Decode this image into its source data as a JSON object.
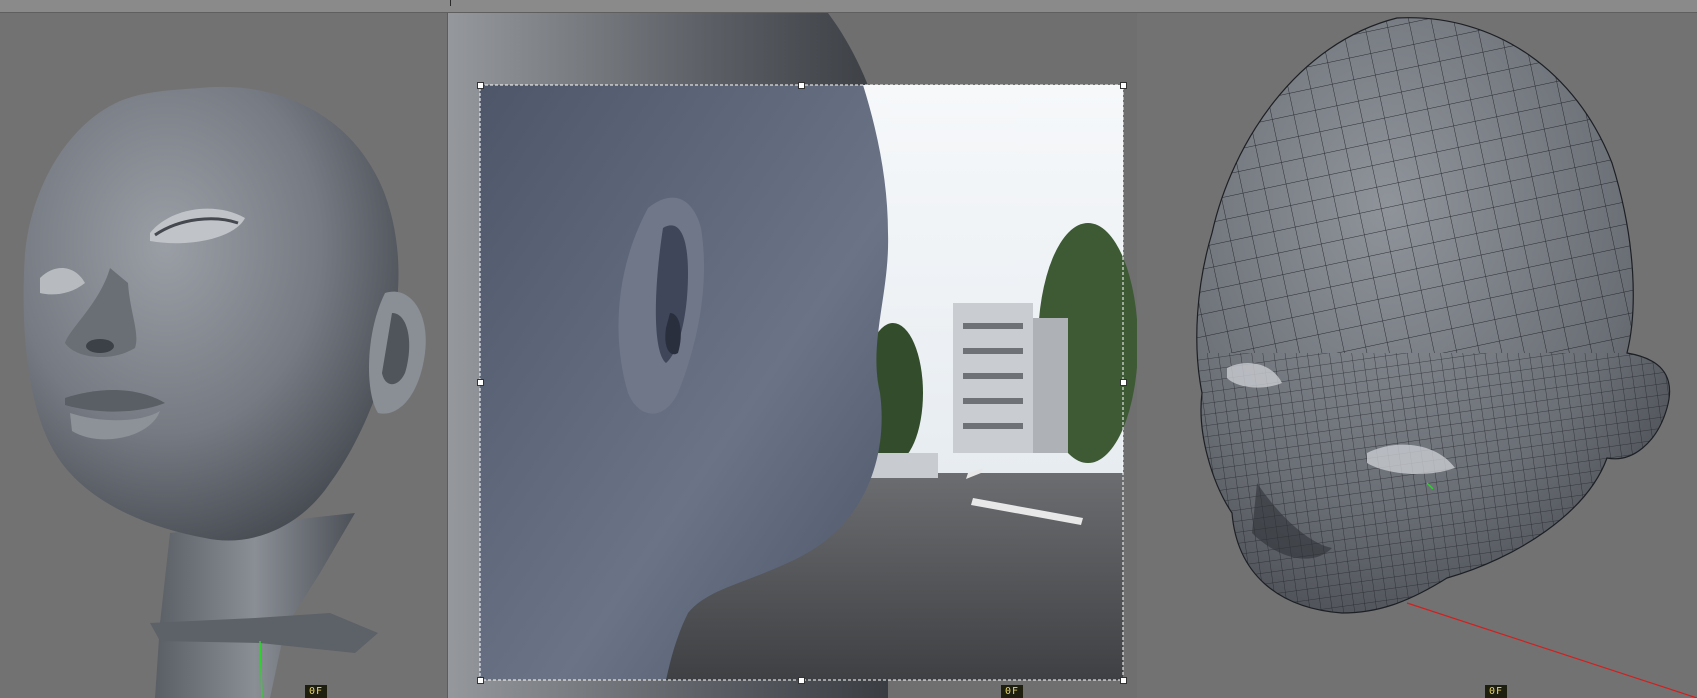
{
  "viewports": [
    {
      "id": "left",
      "label": "perspective-shaded",
      "frame_badge": "0F"
    },
    {
      "id": "middle",
      "label": "camera-background-reference",
      "frame_badge": "0F"
    },
    {
      "id": "right",
      "label": "wireframe-on-shaded",
      "frame_badge": "0F"
    }
  ],
  "colors": {
    "viewport_bg": "#727272",
    "mesh": "#8a8e95",
    "mesh_dark": "#3c4047",
    "wire": "#1c1f24",
    "camera_head": "#5c6478",
    "selection_frame": "#ffffff",
    "badge_bg": "#1f1f10",
    "badge_text": "#e6d56a",
    "axis_green": "#2fd12f",
    "axis_red": "#d02020"
  },
  "icons": [
    "frame-counter-badge",
    "transform-handle",
    "axis-line"
  ]
}
